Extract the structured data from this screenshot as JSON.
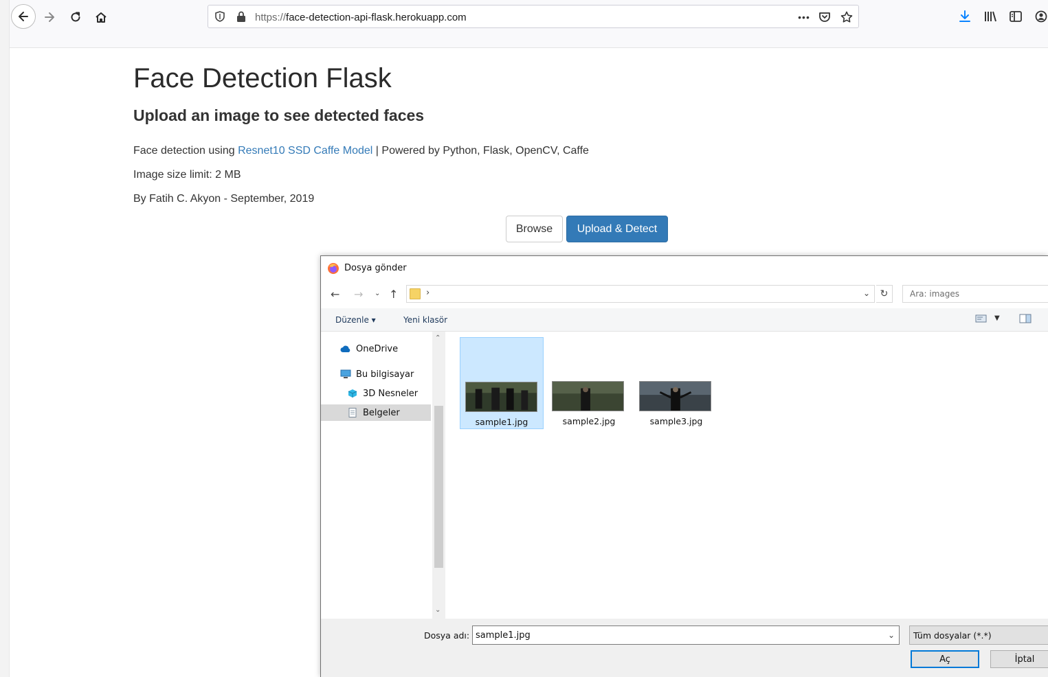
{
  "browser": {
    "url_protocol": "https://",
    "url_host": "face-detection-api-flask.herokuapp.com",
    "icons": [
      "back-arrow-icon",
      "forward-arrow-icon",
      "reload-icon",
      "home-icon",
      "shield-icon",
      "lock-icon",
      "more-dots-icon",
      "pocket-icon",
      "bookmark-star-icon",
      "download-icon",
      "library-icon",
      "sidebar-icon",
      "account-icon"
    ],
    "more_label": "•••"
  },
  "page": {
    "title": "Face Detection Flask",
    "subtitle": "Upload an image to see detected faces",
    "line1_prefix": "Face detection using ",
    "line1_link": "Resnet10 SSD Caffe Model",
    "line1_suffix": " | Powered by Python, Flask, OpenCV, Caffe",
    "line2": "Image size limit: 2 MB",
    "line3": "By Fatih C. Akyon - September, 2019",
    "browse_label": "Browse",
    "upload_label": "Upload & Detect",
    "link_color": "#337ab7",
    "primary_color": "#337ab7"
  },
  "dialog": {
    "title": "Dosya gönder",
    "breadcrumb_sep": "›",
    "search_placeholder": "Ara: images",
    "cmd_organize": "Düzenle ▾",
    "cmd_new_folder": "Yeni klasör",
    "nav": [
      {
        "label": "OneDrive"
      },
      {
        "label": "Bu bilgisayar"
      },
      {
        "label": "3D Nesneler"
      },
      {
        "label": "Belgeler"
      }
    ],
    "files": [
      {
        "name": "sample1.jpg",
        "selected": true
      },
      {
        "name": "sample2.jpg",
        "selected": false
      },
      {
        "name": "sample3.jpg",
        "selected": false
      }
    ],
    "filename_label": "Dosya adı:",
    "filename_value": "sample1.jpg",
    "filter_value": "Tüm dosyalar (*.*)",
    "open_label": "Aç",
    "cancel_label": "İptal",
    "selection_color": "#cce8ff",
    "focus_color": "#0078d7"
  }
}
